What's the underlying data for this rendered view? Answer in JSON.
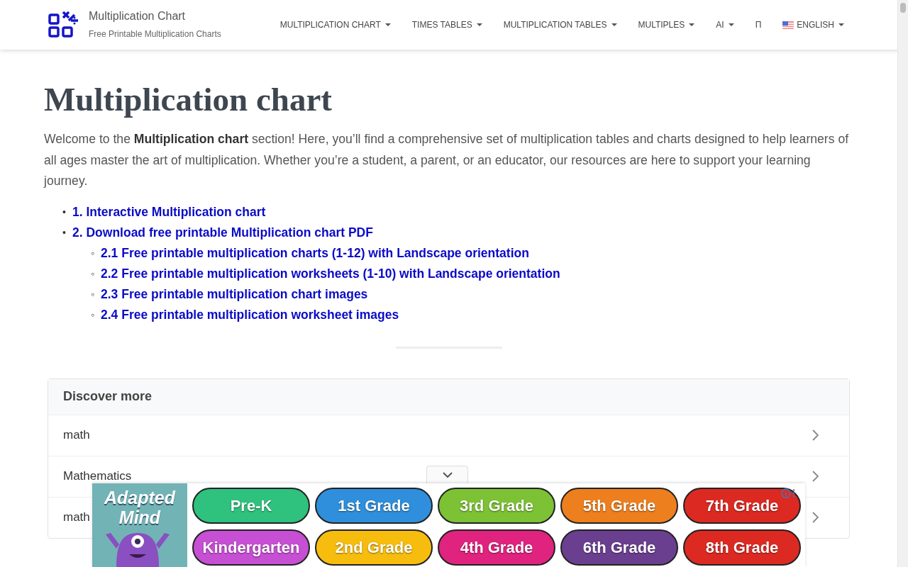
{
  "site": {
    "title": "Multiplication Chart",
    "tagline": "Free Printable Multiplication Charts"
  },
  "nav": [
    {
      "label": "MULTIPLICATION CHART",
      "dropdown": true
    },
    {
      "label": "TIMES TABLES",
      "dropdown": true
    },
    {
      "label": "MULTIPLICATION TABLES",
      "dropdown": true
    },
    {
      "label": "MULTIPLES",
      "dropdown": true
    },
    {
      "label": "AI",
      "dropdown": true
    },
    {
      "label": "Π",
      "dropdown": false
    },
    {
      "label": "ENGLISH",
      "dropdown": true,
      "flag": true
    }
  ],
  "heading": "Multiplication chart",
  "intro": "Welcome to the **Multiplication chart** section! Here, you’ll find a comprehensive set of multiplication tables and charts designed to help learners of all ages master the art of multiplication. Whether you’re a student, a parent, or an educator, our resources are here to support your learning journey.",
  "toc": [
    {
      "marker": "•",
      "label": "1. Interactive Multiplication chart"
    },
    {
      "marker": "•",
      "label": "2. Download free printable Multiplication chart PDF",
      "children": [
        {
          "marker": "◦",
          "label": "2.1 Free printable multiplication charts (1-12) with Landscape orientation"
        },
        {
          "marker": "◦",
          "label": "2.2 Free printable multiplication worksheets (1-10) with Landscape orientation"
        },
        {
          "marker": "◦",
          "label": "2.3 Free printable multiplication chart images"
        },
        {
          "marker": "◦",
          "label": "2.4 Free printable multiplication worksheet images"
        }
      ]
    }
  ],
  "discover": {
    "title": "Discover more",
    "items": [
      "math",
      "Mathematics",
      "math"
    ]
  },
  "ad": {
    "logo": "Adapted Mind",
    "buttons": [
      {
        "label": "Pre-K",
        "color": "#2ec27e"
      },
      {
        "label": "1st Grade",
        "color": "#2f8fdc"
      },
      {
        "label": "3rd Grade",
        "color": "#7cc234"
      },
      {
        "label": "5th Grade",
        "color": "#ee7f1e"
      },
      {
        "label": "7th Grade",
        "color": "#dc2a22"
      },
      {
        "label": "Kindergarten",
        "color": "#c64fd3"
      },
      {
        "label": "2nd Grade",
        "color": "#f7bd0e"
      },
      {
        "label": "4th Grade",
        "color": "#e0237e"
      },
      {
        "label": "6th Grade",
        "color": "#6b3f8f"
      },
      {
        "label": "8th Grade",
        "color": "#dc2a22"
      }
    ]
  }
}
